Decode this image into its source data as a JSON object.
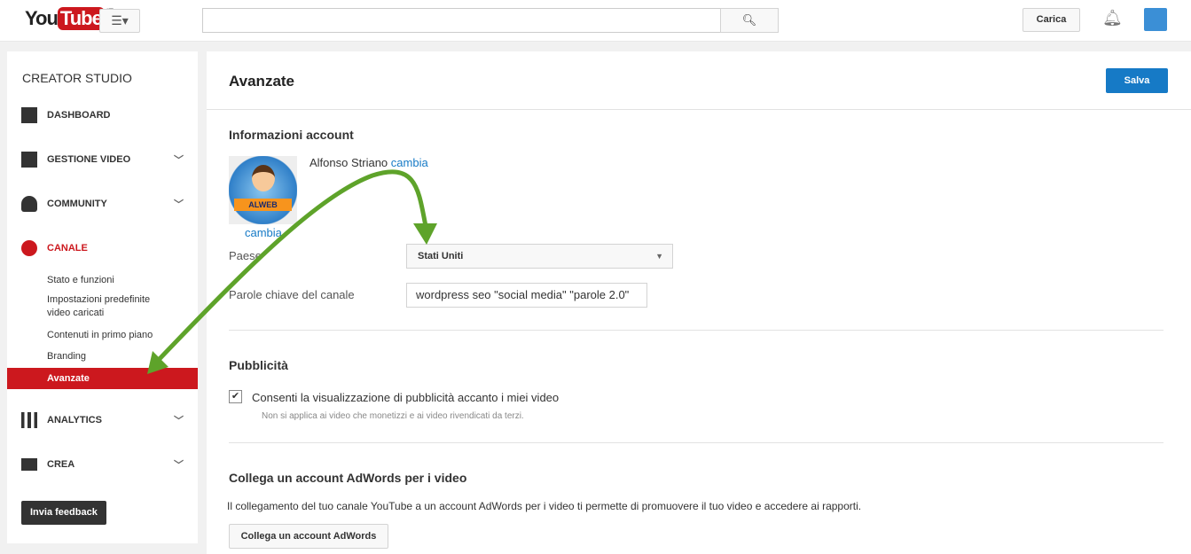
{
  "header": {
    "logo_you": "You",
    "logo_tube": "Tube",
    "logo_region": "IT",
    "search_placeholder": "",
    "upload_label": "Carica"
  },
  "sidebar": {
    "title": "CREATOR STUDIO",
    "items": [
      {
        "label": "DASHBOARD",
        "icon": "dashboard-icon"
      },
      {
        "label": "GESTIONE VIDEO",
        "icon": "video-manager-icon"
      },
      {
        "label": "COMMUNITY",
        "icon": "community-icon"
      },
      {
        "label": "CANALE",
        "icon": "channel-icon"
      },
      {
        "label": "ANALYTICS",
        "icon": "analytics-icon"
      },
      {
        "label": "CREA",
        "icon": "camera-icon"
      }
    ],
    "sub_items": [
      "Stato e funzioni",
      "Impostazioni predefinite video caricati",
      "Contenuti in primo piano",
      "Branding",
      "Avanzate"
    ],
    "feedback_label": "Invia feedback"
  },
  "main": {
    "title": "Avanzate",
    "save_label": "Salva",
    "account": {
      "heading": "Informazioni account",
      "name": "Alfonso Striano",
      "change_link": "cambia",
      "avatar_change": "cambia",
      "avatar_text": "ALWEB",
      "country_label": "Paese",
      "country_value": "Stati Uniti",
      "keywords_label": "Parole chiave del canale",
      "keywords_value": "wordpress seo \"social media\" \"parole 2.0\""
    },
    "ads": {
      "heading": "Pubblicità",
      "checkbox_label": "Consenti la visualizzazione di pubblicità accanto i miei video",
      "checked": true,
      "note": "Non si applica ai video che monetizzi e ai video rivendicati da terzi."
    },
    "adwords": {
      "heading": "Collega un account AdWords per i video",
      "description": "Il collegamento del tuo canale YouTube a un account AdWords per i video ti permette di promuovere il tuo video e accedere ai rapporti.",
      "button_label": "Collega un account AdWords"
    }
  },
  "colors": {
    "accent_red": "#cc181e",
    "link_blue": "#167ac6",
    "annotation_green": "#5ea32a"
  }
}
